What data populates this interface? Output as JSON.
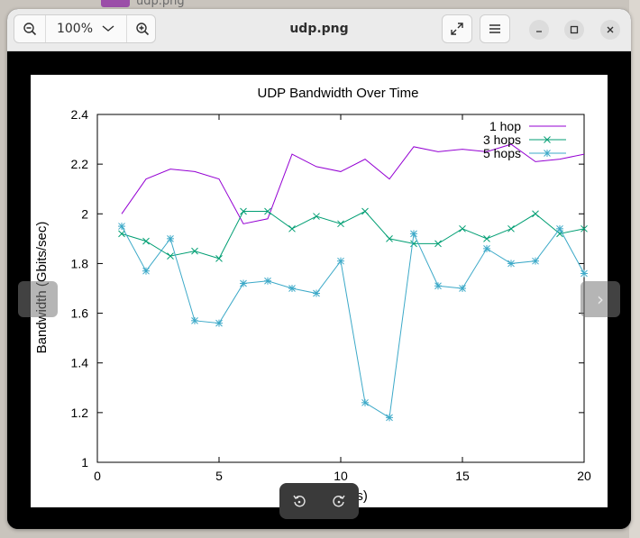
{
  "background": {
    "behind_filename": "udp.png"
  },
  "toolbar": {
    "zoom_out_icon": "zoom-out-icon",
    "zoom_value": "100%",
    "zoom_in_icon": "zoom-in-icon",
    "title": "udp.png",
    "fullscreen_icon": "fullscreen-icon",
    "menu_icon": "hamburger-menu-icon",
    "minimize_icon": "minimize-icon",
    "maximize_icon": "maximize-icon",
    "close_icon": "close-icon"
  },
  "overlay": {
    "prev_icon": "chevron-left-icon",
    "next_icon": "chevron-right-icon",
    "next_glyph": "›",
    "rotate_left_icon": "rotate-left-icon",
    "rotate_right_icon": "rotate-right-icon"
  },
  "colors": {
    "hop1": "#9400d3",
    "hop3": "#009e73",
    "hop5": "#3ca9c8"
  },
  "chart_data": {
    "type": "line",
    "title": "UDP Bandwidth Over Time",
    "xlabel": "(seconds)",
    "ylabel": "Bandwidth (Gbits/sec)",
    "xlim": [
      0,
      20
    ],
    "ylim": [
      1,
      2.4
    ],
    "x_ticks": [
      0,
      5,
      10,
      15,
      20
    ],
    "y_ticks": [
      1,
      1.2,
      1.4,
      1.6,
      1.8,
      2,
      2.2,
      2.4
    ],
    "x_tick_labels": [
      "0",
      "5",
      "10",
      "15",
      "20"
    ],
    "y_tick_labels": [
      "1",
      "1.2",
      "1.4",
      "1.6",
      "1.8",
      "2",
      "2.2",
      "2.4"
    ],
    "legend_position": "top-right",
    "x": [
      1,
      2,
      3,
      4,
      5,
      6,
      7,
      8,
      9,
      10,
      11,
      12,
      13,
      14,
      15,
      16,
      17,
      18,
      19,
      20
    ],
    "series": [
      {
        "name": "1 hop",
        "marker": "none",
        "values": [
          2.0,
          2.14,
          2.18,
          2.17,
          2.14,
          1.96,
          1.98,
          2.24,
          2.19,
          2.17,
          2.22,
          2.14,
          2.27,
          2.25,
          2.26,
          2.25,
          2.28,
          2.21,
          2.22,
          2.24
        ]
      },
      {
        "name": "3 hops",
        "marker": "x",
        "values": [
          1.92,
          1.89,
          1.83,
          1.85,
          1.82,
          2.01,
          2.01,
          1.94,
          1.99,
          1.96,
          2.01,
          1.9,
          1.88,
          1.88,
          1.94,
          1.9,
          1.94,
          2.0,
          1.92,
          1.94
        ]
      },
      {
        "name": "5 hops",
        "marker": "star",
        "values": [
          1.95,
          1.77,
          1.9,
          1.57,
          1.56,
          1.72,
          1.73,
          1.7,
          1.68,
          1.81,
          1.24,
          1.18,
          1.92,
          1.71,
          1.7,
          1.86,
          1.8,
          1.81,
          1.94,
          1.76
        ]
      }
    ]
  }
}
